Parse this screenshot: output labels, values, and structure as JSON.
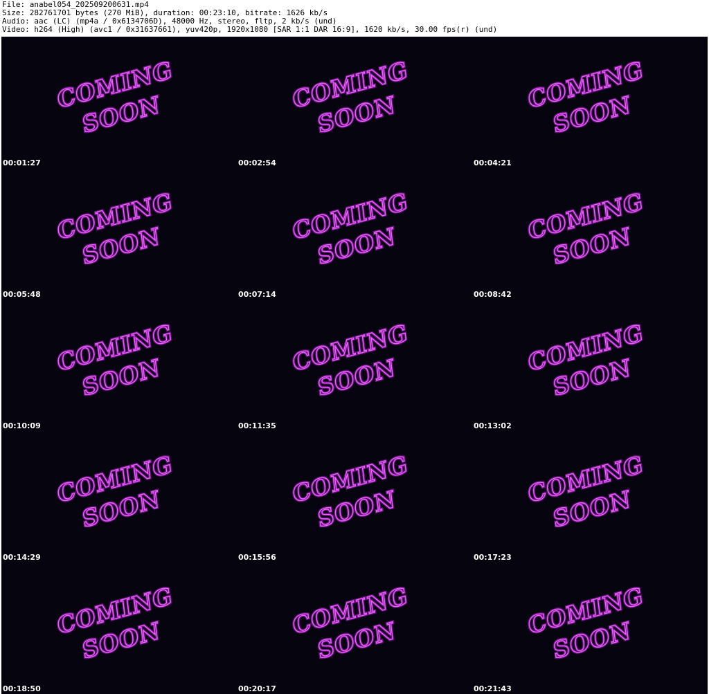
{
  "header": {
    "file_line": "File: anabel054_202509200631.mp4",
    "size_line": "Size: 282761701 bytes (270 MiB), duration: 00:23:10, bitrate: 1626 kb/s",
    "audio_line": "Audio: aac (LC) (mp4a / 0x6134706D), 48000 Hz, stereo, fltp, 2 kb/s (und)",
    "video_line": "Video: h264 (High) (avc1 / 0x31637661), yuv420p, 1920x1080 [SAR 1:1 DAR 16:9], 1620 kb/s, 30.00 fps(r) (und)"
  },
  "frame": {
    "line1": "COMING",
    "line2": "SOON",
    "neon_color": "#f060ff"
  },
  "thumbnails": [
    {
      "timestamp": "00:01:27"
    },
    {
      "timestamp": "00:02:54"
    },
    {
      "timestamp": "00:04:21"
    },
    {
      "timestamp": "00:05:48"
    },
    {
      "timestamp": "00:07:14"
    },
    {
      "timestamp": "00:08:42"
    },
    {
      "timestamp": "00:10:09"
    },
    {
      "timestamp": "00:11:35"
    },
    {
      "timestamp": "00:13:02"
    },
    {
      "timestamp": "00:14:29"
    },
    {
      "timestamp": "00:15:56"
    },
    {
      "timestamp": "00:17:23"
    },
    {
      "timestamp": "00:18:50"
    },
    {
      "timestamp": "00:20:17"
    },
    {
      "timestamp": "00:21:43"
    }
  ]
}
